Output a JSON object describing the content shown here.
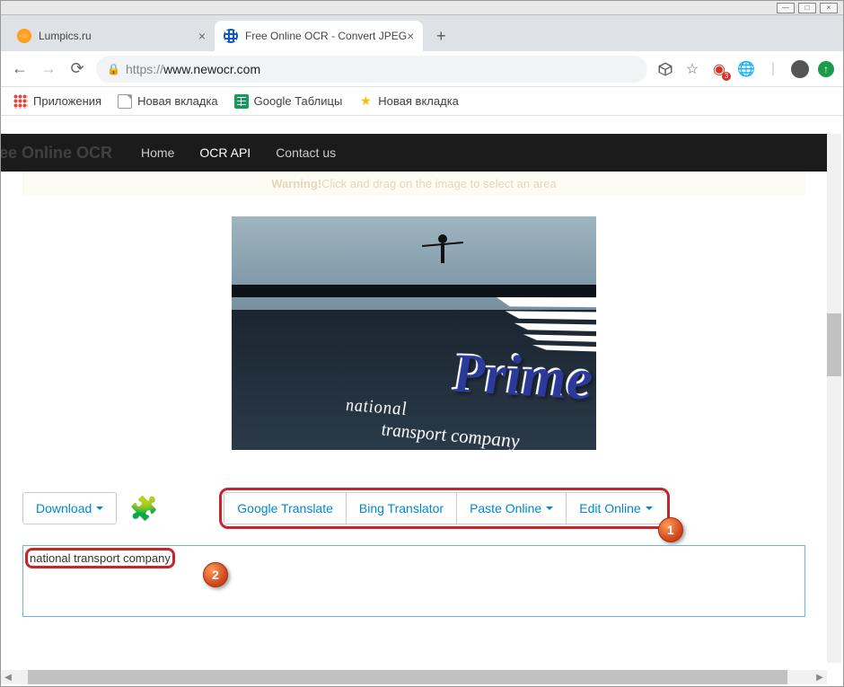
{
  "window": {
    "minimize": "—",
    "maximize": "□",
    "close": "×"
  },
  "tabs": [
    {
      "title": "Lumpics.ru",
      "active": false
    },
    {
      "title": "Free Online OCR - Convert JPEG",
      "active": true
    }
  ],
  "addressbar": {
    "scheme": "https://",
    "host": "www.newocr.com"
  },
  "ext_badge": "3",
  "bookmarks": {
    "apps": "Приложения",
    "newtab1": "Новая вкладка",
    "sheets": "Google Таблицы",
    "newtab2": "Новая вкладка"
  },
  "sitenav": {
    "logo": "ee Online OCR",
    "home": "Home",
    "api": "OCR API",
    "contact": "Contact us"
  },
  "warning": {
    "label": "Warning!",
    "text": " Click and drag on the image to select an area"
  },
  "buttons": {
    "download": "Download",
    "gtranslate": "Google Translate",
    "bing": "Bing Translator",
    "paste": "Paste Online",
    "edit": "Edit Online"
  },
  "result_text": "national transport company",
  "callouts": {
    "one": "1",
    "two": "2"
  },
  "image_sign": {
    "brand": "Prime",
    "line1": "national",
    "line2": "transport  company"
  }
}
